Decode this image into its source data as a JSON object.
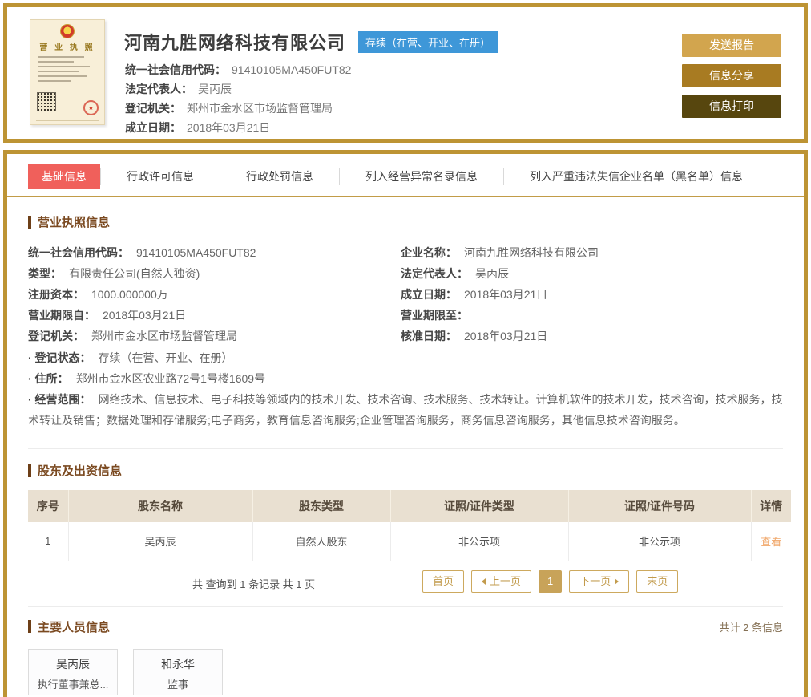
{
  "colors": {
    "accent_gold_border": "#bd9434",
    "tab_active_red": "#f0605b",
    "status_badge_blue": "#3e97d8",
    "section_title_brown": "#7b4a21",
    "table_header_bg": "#e9e0d1",
    "view_link_orange": "#f0a76a",
    "pager_gold": "#c8a359",
    "button_send_gold": "#d2a54e",
    "button_share_brown": "#a87b22",
    "button_print_dark": "#57460e"
  },
  "header": {
    "company_name": "河南九胜网络科技有限公司",
    "status_badge": "存续（在营、开业、在册）",
    "license_title": "营 业 执 照",
    "fields": [
      {
        "label": "统一社会信用代码：",
        "value": "91410105MA450FUT82"
      },
      {
        "label": "法定代表人：",
        "value": "吴丙辰"
      },
      {
        "label": "登记机关：",
        "value": "郑州市金水区市场监督管理局"
      },
      {
        "label": "成立日期：",
        "value": "2018年03月21日"
      }
    ],
    "buttons": [
      {
        "label": "发送报告"
      },
      {
        "label": "信息分享"
      },
      {
        "label": "信息打印"
      }
    ]
  },
  "tabs": [
    {
      "label": "基础信息",
      "active": true
    },
    {
      "label": "行政许可信息",
      "active": false
    },
    {
      "label": "行政处罚信息",
      "active": false
    },
    {
      "label": "列入经营异常名录信息",
      "active": false
    },
    {
      "label": "列入严重违法失信企业名单（黑名单）信息",
      "active": false
    }
  ],
  "license_section": {
    "title": "营业执照信息",
    "left_fields": [
      {
        "label": "统一社会信用代码：",
        "value": "91410105MA450FUT82"
      },
      {
        "label": "类型：",
        "value": "有限责任公司(自然人独资)"
      },
      {
        "label": "注册资本：",
        "value": "1000.000000万"
      },
      {
        "label": "营业期限自：",
        "value": "2018年03月21日"
      },
      {
        "label": "登记机关：",
        "value": "郑州市金水区市场监督管理局"
      }
    ],
    "right_fields": [
      {
        "label": "企业名称：",
        "value": "河南九胜网络科技有限公司"
      },
      {
        "label": "法定代表人：",
        "value": "吴丙辰"
      },
      {
        "label": "成立日期：",
        "value": "2018年03月21日"
      },
      {
        "label": "营业期限至：",
        "value": ""
      },
      {
        "label": "核准日期：",
        "value": "2018年03月21日"
      }
    ],
    "full_fields": [
      {
        "label": "· 登记状态：",
        "value": "存续（在营、开业、在册）"
      },
      {
        "label": "· 住所：",
        "value": "郑州市金水区农业路72号1号楼1609号"
      },
      {
        "label": "· 经营范围：",
        "value": "网络技术、信息技术、电子科技等领域内的技术开发、技术咨询、技术服务、技术转让。计算机软件的技术开发，技术咨询，技术服务，技术转让及销售；数据处理和存储服务;电子商务，教育信息咨询服务;企业管理咨询服务，商务信息咨询服务，其他信息技术咨询服务。"
      }
    ]
  },
  "shareholders": {
    "title": "股东及出资信息",
    "columns": [
      "序号",
      "股东名称",
      "股东类型",
      "证照/证件类型",
      "证照/证件号码",
      "详情"
    ],
    "rows": [
      [
        "1",
        "吴丙辰",
        "自然人股东",
        "非公示项",
        "非公示项"
      ]
    ],
    "view_link": "查看",
    "summary": "共 查询到 1 条记录 共 1 页",
    "pagination": {
      "first": "首页",
      "prev": "上一页",
      "page": "1",
      "next": "下一页",
      "last": "末页"
    }
  },
  "staff": {
    "title": "主要人员信息",
    "count_text": "共计 2 条信息",
    "persons": [
      {
        "name": "吴丙辰",
        "position": "执行董事兼总..."
      },
      {
        "name": "和永华",
        "position": "监事"
      }
    ]
  }
}
